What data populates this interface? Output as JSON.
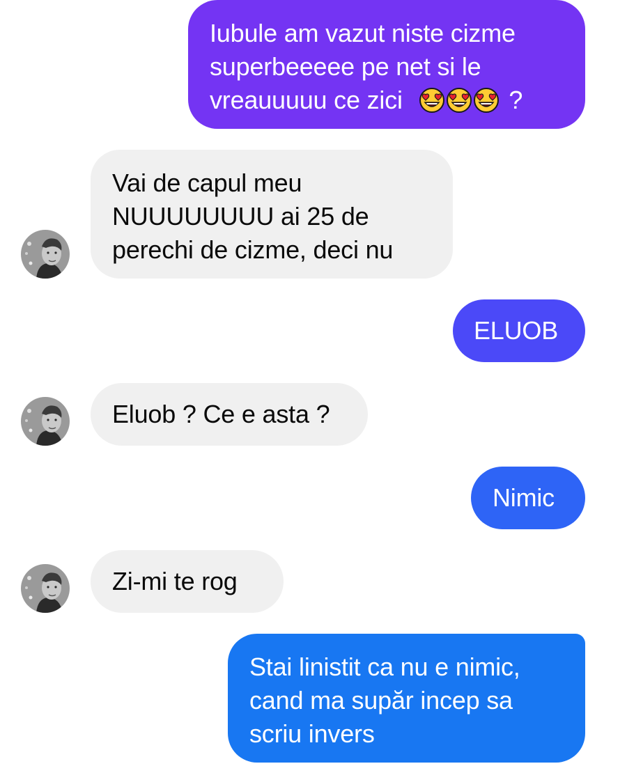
{
  "conversation": {
    "messages": [
      {
        "direction": "outgoing",
        "lines": [
          "Iubule am vazut niste cizme",
          "superbeeeee pe net si le",
          "vreauuuuu ce zici"
        ],
        "trailing_emojis": [
          "smiling-face-with-heart-eyes",
          "smiling-face-with-heart-eyes",
          "smiling-face-with-heart-eyes"
        ],
        "trailing_text": "?",
        "bubble_color": "#7434f3"
      },
      {
        "direction": "incoming",
        "lines": [
          "Vai de capul meu",
          "NUUUUUUUU ai 25 de",
          "perechi de cizme, deci nu"
        ]
      },
      {
        "direction": "outgoing",
        "lines": [
          "ELUOB"
        ],
        "bubble_color": "#4b49f8"
      },
      {
        "direction": "incoming",
        "lines": [
          "Eluob ? Ce e asta ?"
        ]
      },
      {
        "direction": "outgoing",
        "lines": [
          "Nimic"
        ],
        "bubble_color": "#2e64f6"
      },
      {
        "direction": "incoming",
        "lines": [
          "Zi-mi te rog"
        ]
      },
      {
        "direction": "outgoing",
        "lines": [
          "Stai linistit ca nu e nimic,",
          "cand ma supăr incep sa",
          "scriu invers"
        ],
        "bubble_color": "#1877f2"
      }
    ]
  },
  "colors": {
    "incoming_bubble": "#f0f0f0",
    "incoming_text": "#0a0a0a",
    "outgoing_text": "#ffffff",
    "background": "#ffffff"
  },
  "icons": {
    "avatar": "contact-avatar-photo",
    "emoji": "smiling-face-with-heart-eyes"
  }
}
